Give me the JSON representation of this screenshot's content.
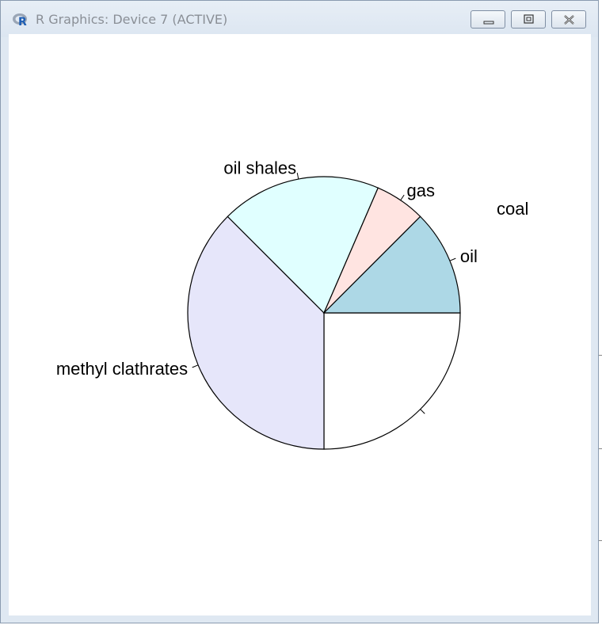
{
  "window": {
    "title": "R Graphics: Device 7 (ACTIVE)"
  },
  "icons": {
    "app": "r-logo-icon",
    "minimize": "minimize-icon",
    "maximize": "maximize-icon",
    "close": "close-icon"
  },
  "chart_data": {
    "type": "pie",
    "title": "",
    "slices": [
      {
        "label": "coal",
        "value": 0.25,
        "color": "#ffffff"
      },
      {
        "label": "methyl clathrates",
        "value": 0.375,
        "color": "#e6e6fa"
      },
      {
        "label": "oil shales",
        "value": 0.19,
        "color": "#e0ffff"
      },
      {
        "label": "gas",
        "value": 0.06,
        "color": "#ffe4e1"
      },
      {
        "label": "oil",
        "value": 0.125,
        "color": "#add8e6"
      }
    ],
    "start": "3 o'clock",
    "direction": "clockwise",
    "border_color": "#000000"
  }
}
